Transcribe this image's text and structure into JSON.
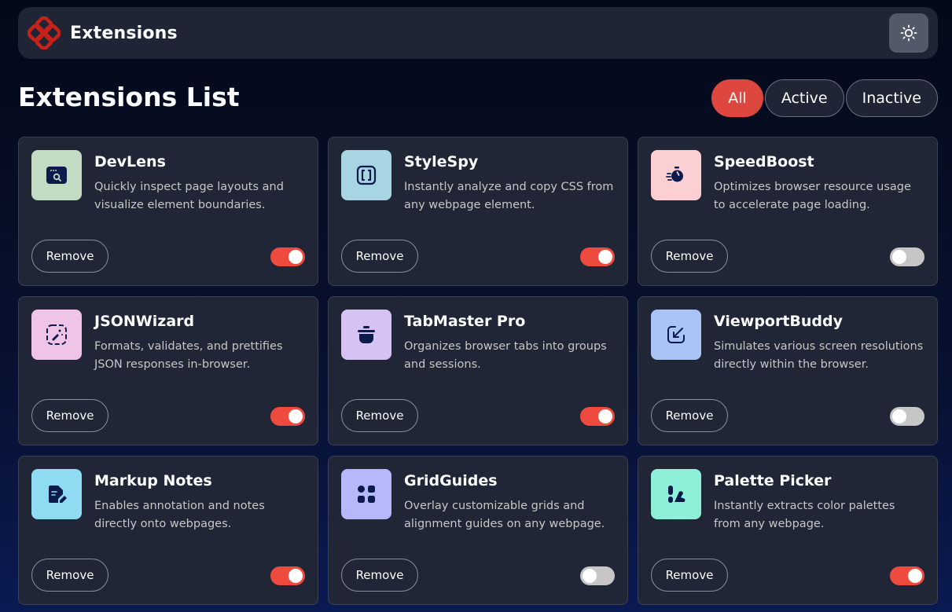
{
  "header": {
    "app_name": "Extensions",
    "theme_icon": "sun-icon"
  },
  "page": {
    "title": "Extensions List"
  },
  "filters": [
    {
      "label": "All",
      "selected": true
    },
    {
      "label": "Active",
      "selected": false
    },
    {
      "label": "Inactive",
      "selected": false
    }
  ],
  "colors": {
    "accent": "#de473f",
    "toggle_on": "#ee4a3e",
    "toggle_off": "#c6c6c6",
    "card_bg": "#212636"
  },
  "extensions": [
    {
      "name": "DevLens",
      "description": "Quickly inspect page layouts and visualize element boundaries.",
      "icon": "devlens-icon",
      "icon_bg": "#c2dbc2",
      "active": true,
      "remove_label": "Remove"
    },
    {
      "name": "StyleSpy",
      "description": "Instantly analyze and copy CSS from any webpage element.",
      "icon": "stylespy-icon",
      "icon_bg": "#a8d5e2",
      "active": true,
      "remove_label": "Remove"
    },
    {
      "name": "SpeedBoost",
      "description": "Optimizes browser resource usage to accelerate page loading.",
      "icon": "speedboost-icon",
      "icon_bg": "#fcd0d3",
      "active": false,
      "remove_label": "Remove"
    },
    {
      "name": "JSONWizard",
      "description": "Formats, validates, and prettifies JSON responses in-browser.",
      "icon": "jsonwizard-icon",
      "icon_bg": "#efc4e7",
      "active": true,
      "remove_label": "Remove"
    },
    {
      "name": "TabMaster Pro",
      "description": "Organizes browser tabs into groups and sessions.",
      "icon": "tabmaster-icon",
      "icon_bg": "#d6c3f4",
      "active": true,
      "remove_label": "Remove"
    },
    {
      "name": "ViewportBuddy",
      "description": "Simulates various screen resolutions directly within the browser.",
      "icon": "viewportbuddy-icon",
      "icon_bg": "#a9c4f5",
      "active": false,
      "remove_label": "Remove"
    },
    {
      "name": "Markup Notes",
      "description": "Enables annotation and notes directly onto webpages.",
      "icon": "markupnotes-icon",
      "icon_bg": "#8fdcf2",
      "active": true,
      "remove_label": "Remove"
    },
    {
      "name": "GridGuides",
      "description": "Overlay customizable grids and alignment guides on any webpage.",
      "icon": "gridguides-icon",
      "icon_bg": "#b7b8fa",
      "active": false,
      "remove_label": "Remove"
    },
    {
      "name": "Palette Picker",
      "description": "Instantly extracts color palettes from any webpage.",
      "icon": "palettepicker-icon",
      "icon_bg": "#8ef0d9",
      "active": true,
      "remove_label": "Remove"
    }
  ]
}
